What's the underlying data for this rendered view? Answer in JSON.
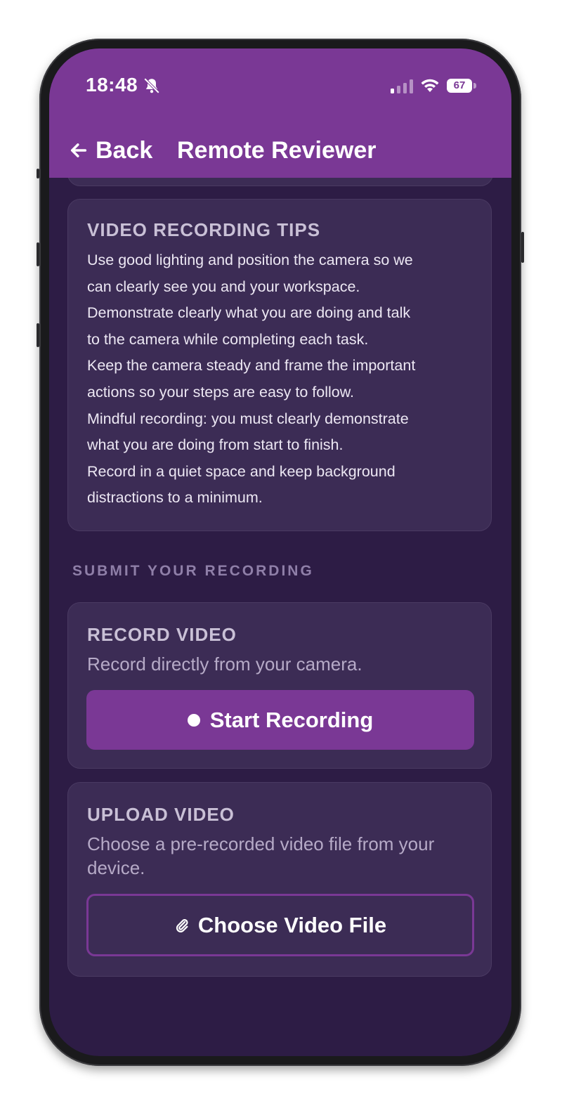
{
  "status_bar": {
    "time": "18:48",
    "battery": "67",
    "icons": [
      "bell-slash-icon",
      "cellular-signal-icon",
      "wifi-icon",
      "battery-icon"
    ]
  },
  "header": {
    "back_label": "Back",
    "title": "Remote Reviewer",
    "back_icon": "arrow-left-icon"
  },
  "tips_card": {
    "title": "VIDEO RECORDING TIPS",
    "lines": [
      "Use good lighting and position the camera so we",
      "can clearly see you and your workspace.",
      "Demonstrate clearly what you are doing and talk",
      "to the camera while completing each task.",
      "Keep the camera steady and frame the important",
      "actions so your steps are easy to follow.",
      "Mindful recording: you must clearly demonstrate",
      "what you are doing from start to finish.",
      "Record in a quiet space and keep background",
      "distractions to a minimum."
    ]
  },
  "submit_section": {
    "label": "SUBMIT YOUR RECORDING"
  },
  "record_card": {
    "title": "RECORD VIDEO",
    "description": "Record directly from your camera.",
    "button_label": "Start Recording",
    "button_icon": "record-dot-icon"
  },
  "upload_card": {
    "title": "UPLOAD VIDEO",
    "description": "Choose a pre-recorded video file from your device.",
    "button_label": "Choose Video File",
    "button_icon": "paperclip-icon"
  },
  "colors": {
    "accent": "#7a3895",
    "background": "#2d1c45",
    "card": "#3c2c55"
  }
}
